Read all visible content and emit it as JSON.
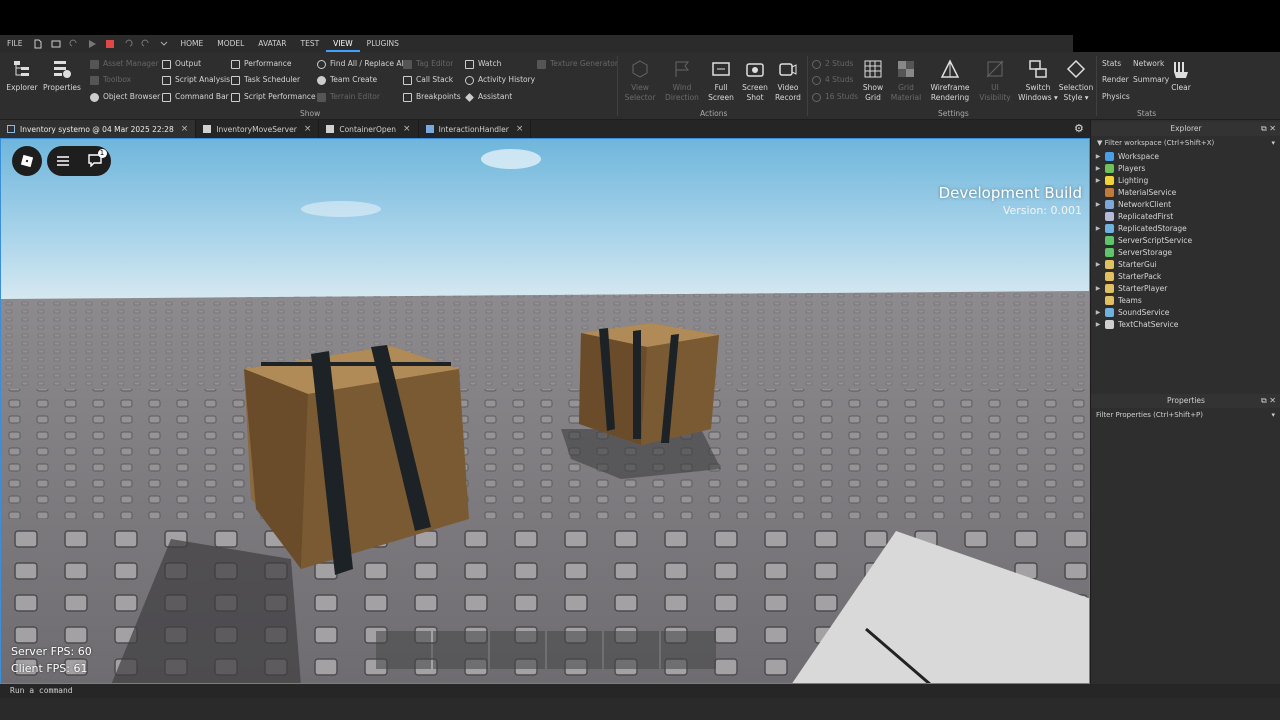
{
  "menu": {
    "items": [
      "FILE",
      "HOME",
      "MODEL",
      "AVATAR",
      "TEST",
      "VIEW",
      "PLUGINS"
    ],
    "active": "VIEW"
  },
  "ribbon": {
    "explorer": "Explorer",
    "properties": "Properties",
    "asset_manager": "Asset Manager",
    "toolbox": "Toolbox",
    "object_browser": "Object Browser",
    "output": "Output",
    "script_analysis": "Script Analysis",
    "command_bar": "Command Bar",
    "performance": "Performance",
    "task_scheduler": "Task Scheduler",
    "script_performance": "Script Performance",
    "find_all": "Find All / Replace All",
    "team_create": "Team Create",
    "terrain_editor": "Terrain Editor",
    "tag_editor": "Tag Editor",
    "call_stack": "Call Stack",
    "breakpoints": "Breakpoints",
    "watch": "Watch",
    "activity_history": "Activity History",
    "assistant": "Assistant",
    "texture_generator": "Texture Generator",
    "show_label": "Show",
    "view_selector": [
      "View",
      "Selector"
    ],
    "wind_direction": [
      "Wind",
      "Direction"
    ],
    "full_screen": [
      "Full",
      "Screen"
    ],
    "screen_shot": [
      "Screen",
      "Shot"
    ],
    "video_record": [
      "Video",
      "Record"
    ],
    "actions_label": "Actions",
    "studs_2": "2 Studs",
    "studs_4": "4 Studs",
    "studs_16": "16 Studs",
    "show_grid": [
      "Show",
      "Grid"
    ],
    "grid_material": [
      "Grid",
      "Material"
    ],
    "wireframe": [
      "Wireframe",
      "Rendering"
    ],
    "ui_visibility": "UI Visibility",
    "switch_windows": [
      "Switch",
      "Windows ▾"
    ],
    "selection_style": [
      "Selection",
      "Style ▾"
    ],
    "settings_label": "Settings",
    "stats": "Stats",
    "network": "Network",
    "render": "Render",
    "summary": "Summary",
    "physics": "Physics",
    "clear": "Clear",
    "stats_label": "Stats"
  },
  "tabs": [
    {
      "label": "Inventory systemo @ 04 Mar 2025 22:28",
      "icon": "place-icon"
    },
    {
      "label": "InventoryMoveServer",
      "icon": "script-icon"
    },
    {
      "label": "ContainerOpen",
      "icon": "script-icon"
    },
    {
      "label": "InteractionHandler",
      "icon": "localscript-icon"
    }
  ],
  "viewport": {
    "dev_build": "Development Build",
    "version": "Version: 0.001",
    "server_fps": "Server FPS: 60",
    "client_fps": "Client FPS: 61",
    "notification_count": "1",
    "hotbar_slots": 6
  },
  "explorer": {
    "title": "Explorer",
    "filter": "Filter workspace (Ctrl+Shift+X)",
    "items": [
      {
        "label": "Workspace",
        "expand": true,
        "color": "#4aa0e6"
      },
      {
        "label": "Players",
        "expand": true,
        "color": "#6fc25a"
      },
      {
        "label": "Lighting",
        "expand": true,
        "color": "#f2d23a"
      },
      {
        "label": "MaterialService",
        "expand": false,
        "color": "#c07a3a"
      },
      {
        "label": "NetworkClient",
        "expand": true,
        "color": "#7fa8d8"
      },
      {
        "label": "ReplicatedFirst",
        "expand": false,
        "color": "#b8b8d8"
      },
      {
        "label": "ReplicatedStorage",
        "expand": true,
        "color": "#6fb2e0"
      },
      {
        "label": "ServerScriptService",
        "expand": false,
        "color": "#5fc46a"
      },
      {
        "label": "ServerStorage",
        "expand": false,
        "color": "#5fc46a"
      },
      {
        "label": "StarterGui",
        "expand": true,
        "color": "#e0c060"
      },
      {
        "label": "StarterPack",
        "expand": false,
        "color": "#e0c060"
      },
      {
        "label": "StarterPlayer",
        "expand": true,
        "color": "#e0c060"
      },
      {
        "label": "Teams",
        "expand": false,
        "color": "#e0c060"
      },
      {
        "label": "SoundService",
        "expand": true,
        "color": "#6fb2e0"
      },
      {
        "label": "TextChatService",
        "expand": true,
        "color": "#d0d0d0"
      }
    ]
  },
  "properties": {
    "title": "Properties",
    "filter": "Filter Properties (Ctrl+Shift+P)"
  },
  "command_bar": {
    "placeholder": "Run a command"
  }
}
